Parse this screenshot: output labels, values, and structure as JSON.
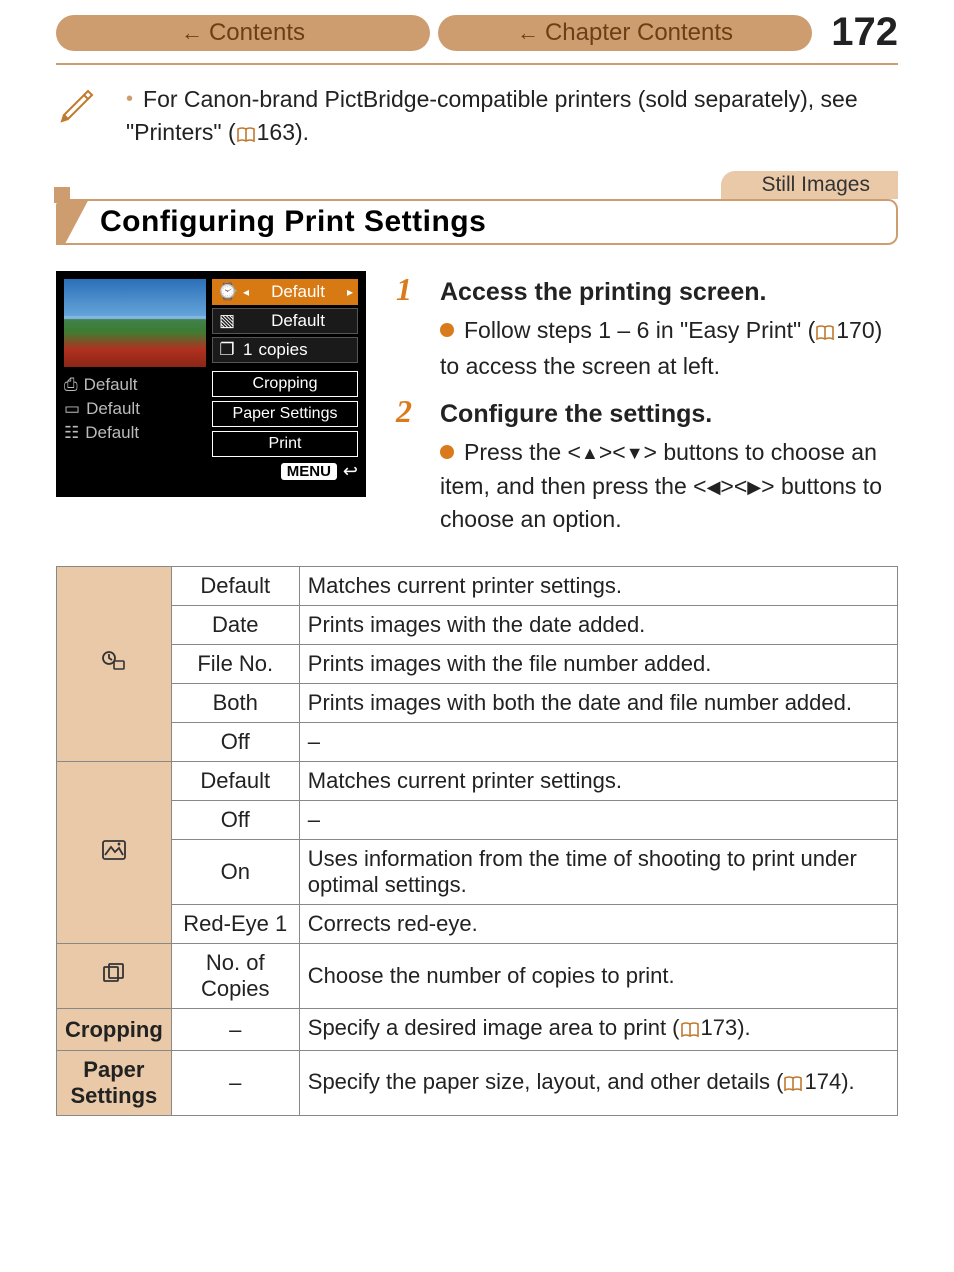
{
  "header": {
    "contents_label": "Contents",
    "chapter_label": "Chapter Contents",
    "page_number": "172"
  },
  "note": {
    "text_a": "For Canon-brand PictBridge-compatible printers (sold separately), see \"Printers\" (",
    "link": "163",
    "text_b": ")."
  },
  "tag": "Still Images",
  "heading": "Configuring Print Settings",
  "camera_screen": {
    "opt1": "Default",
    "opt2": "Default",
    "copies_value": "1",
    "copies_label": "copies",
    "btn_cropping": "Cropping",
    "btn_paper": "Paper Settings",
    "btn_print": "Print",
    "left1": "Default",
    "left2": "Default",
    "left3": "Default",
    "menu_label": "MENU"
  },
  "steps": {
    "s1_num": "1",
    "s1_title": "Access the printing screen.",
    "s1_body_a": "Follow steps 1 – 6 in \"Easy Print\" (",
    "s1_link": "170",
    "s1_body_b": ") to access the screen at left.",
    "s2_num": "2",
    "s2_title": "Configure the settings.",
    "s2_body_a": "Press the <",
    "s2_body_b": "><",
    "s2_body_c": "> buttons to choose an item, and then press the <",
    "s2_body_d": "><",
    "s2_body_e": "> buttons to choose an option."
  },
  "table": {
    "g1": {
      "r1o": "Default",
      "r1d": "Matches current printer settings.",
      "r2o": "Date",
      "r2d": "Prints images with the date added.",
      "r3o": "File No.",
      "r3d": "Prints images with the file number added.",
      "r4o": "Both",
      "r4d": "Prints images with both the date and file number added.",
      "r5o": "Off",
      "r5d": "–"
    },
    "g2": {
      "r1o": "Default",
      "r1d": "Matches current printer settings.",
      "r2o": "Off",
      "r2d": "–",
      "r3o": "On",
      "r3d": "Uses information from the time of shooting to print under optimal settings.",
      "r4o": "Red-Eye 1",
      "r4d": "Corrects red-eye."
    },
    "g3": {
      "o": "No. of Copies",
      "d": "Choose the number of copies to print."
    },
    "g4": {
      "label": "Cropping",
      "o": "–",
      "d_a": "Specify a desired image area to print (",
      "link": "173",
      "d_b": ")."
    },
    "g5": {
      "label": "Paper Settings",
      "o": "–",
      "d_a": "Specify the paper size, layout, and other details (",
      "link": "174",
      "d_b": ")."
    }
  }
}
